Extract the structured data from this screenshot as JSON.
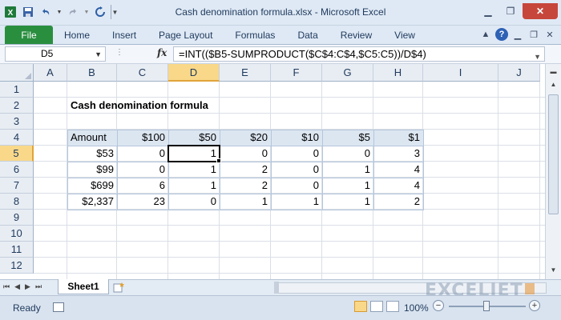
{
  "window": {
    "title": "Cash denomination formula.xlsx  -  Microsoft Excel"
  },
  "ribbon": {
    "tabs": [
      "File",
      "Home",
      "Insert",
      "Page Layout",
      "Formulas",
      "Data",
      "Review",
      "View"
    ]
  },
  "formula_bar": {
    "name_box": "D5",
    "fx": "fx",
    "formula": "=INT(($B5-SUMPRODUCT($C$4:C$4,$C5:C5))/D$4)"
  },
  "columns": [
    "A",
    "B",
    "C",
    "D",
    "E",
    "F",
    "G",
    "H",
    "I",
    "J"
  ],
  "rows": [
    "1",
    "2",
    "3",
    "4",
    "5",
    "6",
    "7",
    "8",
    "9",
    "10",
    "11",
    "12"
  ],
  "selected": {
    "column": "D",
    "row": "5"
  },
  "sheet": {
    "title": "Cash denomination formula",
    "table": {
      "headers": [
        "Amount",
        "$100",
        "$50",
        "$20",
        "$10",
        "$5",
        "$1"
      ],
      "rows": [
        [
          "$53",
          "0",
          "1",
          "0",
          "0",
          "0",
          "3"
        ],
        [
          "$99",
          "0",
          "1",
          "2",
          "0",
          "1",
          "4"
        ],
        [
          "$699",
          "6",
          "1",
          "2",
          "0",
          "1",
          "4"
        ],
        [
          "$2,337",
          "23",
          "0",
          "1",
          "1",
          "1",
          "2"
        ]
      ]
    }
  },
  "sheet_tabs": {
    "active": "Sheet1"
  },
  "watermark": "EXCELJET",
  "status": {
    "ready": "Ready",
    "zoom": "100%",
    "zoom_minus": "−",
    "zoom_plus": "+"
  },
  "colors": {
    "file_tab": "#2a8e3f",
    "header_fill": "#dce6f1",
    "selection": "#f9d88a"
  }
}
